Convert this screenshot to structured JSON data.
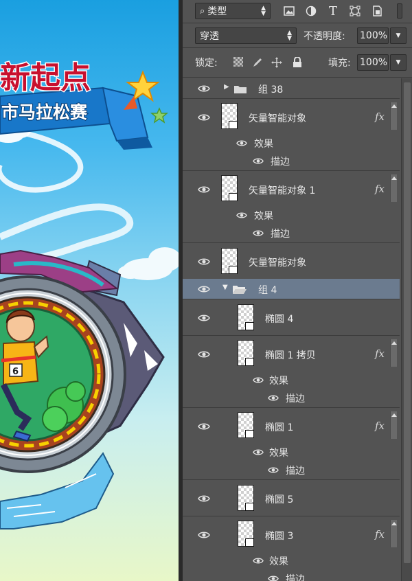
{
  "canvas": {
    "banner_title": "新起点",
    "ribbon_text": "市马拉松赛",
    "bib_number": "6"
  },
  "toolbar": {
    "filter_kind_label": "类型",
    "icons": [
      "image-filter-icon",
      "adjustment-filter-icon",
      "type-filter-icon",
      "shape-filter-icon",
      "smart-object-filter-icon"
    ],
    "type_glyph": "T"
  },
  "blend": {
    "mode_value": "穿透",
    "opacity_label": "不透明度:",
    "opacity_value": "100%"
  },
  "lock": {
    "label": "锁定:",
    "fill_label": "填充:",
    "fill_value": "100%"
  },
  "layers": {
    "group38": {
      "name": "组 38"
    },
    "so1": {
      "name": "矢量智能对象",
      "effects_label": "效果",
      "stroke_label": "描边",
      "fx": "fx"
    },
    "so2": {
      "name": "矢量智能对象 1",
      "effects_label": "效果",
      "stroke_label": "描边",
      "fx": "fx"
    },
    "so3": {
      "name": "矢量智能对象"
    },
    "group4": {
      "name": "组 4"
    },
    "ell4": {
      "name": "椭圆 4"
    },
    "ell1copy": {
      "name": "椭圆 1 拷贝",
      "effects_label": "效果",
      "stroke_label": "描边",
      "fx": "fx"
    },
    "ell1": {
      "name": "椭圆 1",
      "effects_label": "效果",
      "stroke_label": "描边",
      "fx": "fx"
    },
    "ell5": {
      "name": "椭圆 5"
    },
    "ell3": {
      "name": "椭圆 3",
      "effects_label": "效果",
      "stroke_label": "描边",
      "fx": "fx"
    }
  },
  "colors": {
    "panel_bg": "#535353",
    "selected_row": "#6b7b8f",
    "sky_top": "#1a9fe0",
    "banner_red": "#c8102e",
    "track_yellow": "#f7d100",
    "field_green": "#2fa865"
  }
}
